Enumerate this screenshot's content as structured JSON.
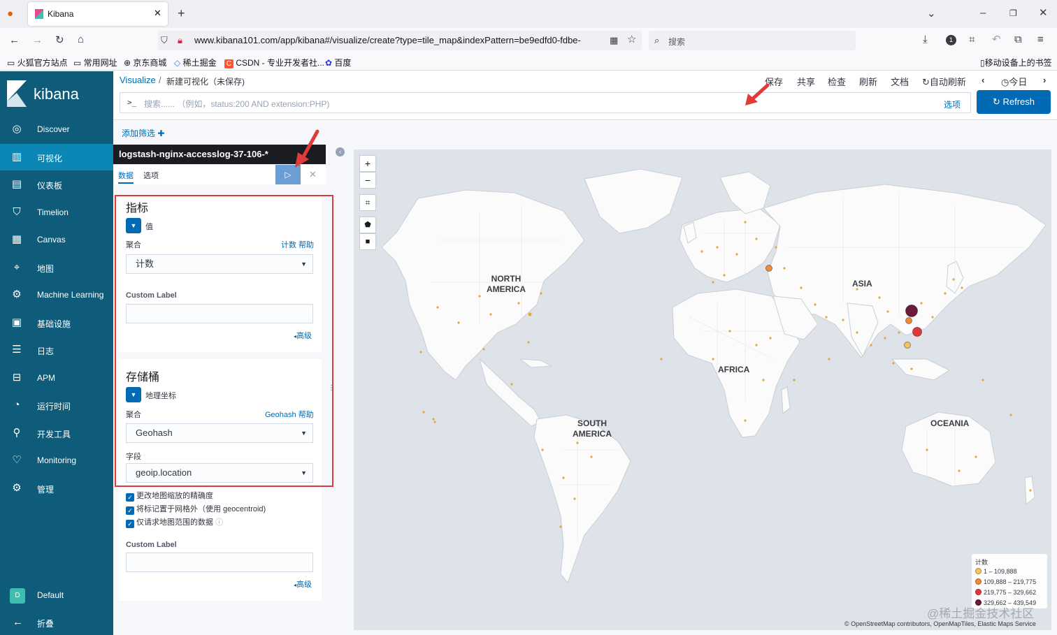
{
  "browser": {
    "tab_title": "Kibana",
    "url": "www.kibana101.com/app/kibana#/visualize/create?type=tile_map&indexPattern=be9edfd0-fdbe-",
    "search_placeholder": "搜索",
    "bookmarks": [
      "火狐官方站点",
      "常用网址",
      "京东商城",
      "稀土掘金",
      "CSDN - 专业开发者社...",
      "百度"
    ],
    "mobile_bookmarks": "移动设备上的书签"
  },
  "kibana": {
    "logo_text": "kibana",
    "breadcrumb_root": "Visualize",
    "breadcrumb_sep": "/",
    "breadcrumb_current": "新建可视化（未保存)",
    "menu": [
      "保存",
      "共享",
      "检查",
      "刷新",
      "文档"
    ],
    "auto_refresh": "自动刷新",
    "time_label": "今日",
    "query_prompt": ">_",
    "query_placeholder": "搜索...... （例如，status:200 AND extension:PHP)",
    "options_link": "选项",
    "refresh_button": "Refresh",
    "add_filter": "添加筛选"
  },
  "sidebar": {
    "items": [
      {
        "label": "Discover",
        "icon": "compass-icon"
      },
      {
        "label": "可视化",
        "icon": "chart-icon"
      },
      {
        "label": "仪表板",
        "icon": "dashboard-icon"
      },
      {
        "label": "Timelion",
        "icon": "shield-icon"
      },
      {
        "label": "Canvas",
        "icon": "canvas-icon"
      },
      {
        "label": "地图",
        "icon": "map-pin-icon"
      },
      {
        "label": "Machine Learning",
        "icon": "ml-icon"
      },
      {
        "label": "基础设施",
        "icon": "infra-icon"
      },
      {
        "label": "日志",
        "icon": "log-icon"
      },
      {
        "label": "APM",
        "icon": "apm-icon"
      },
      {
        "label": "运行时间",
        "icon": "uptime-icon"
      },
      {
        "label": "开发工具",
        "icon": "wrench-icon"
      },
      {
        "label": "Monitoring",
        "icon": "heartbeat-icon"
      },
      {
        "label": "管理",
        "icon": "gear-icon"
      }
    ],
    "space_badge": "D",
    "space_name": "Default",
    "collapse": "折叠"
  },
  "editor": {
    "index_pattern": "logstash-nginx-accesslog-37-106-*",
    "tabs": [
      "数据",
      "选项"
    ],
    "metrics": {
      "title": "指标",
      "item": "值",
      "agg_label": "聚合",
      "agg_help": "计数 帮助",
      "agg_value": "计数",
      "custom_label": "Custom Label",
      "advanced": "高级"
    },
    "buckets": {
      "title": "存储桶",
      "item": "地理坐标",
      "agg_label": "聚合",
      "agg_help": "Geohash 帮助",
      "agg_value": "Geohash",
      "field_label": "字段",
      "field_value": "geoip.location",
      "checkboxes": [
        "更改地图缩放的精确度",
        "将标记置于网格外（使用 geocentroid)",
        "仅请求地图范围的数据"
      ],
      "custom_label": "Custom Label",
      "advanced": "高级"
    }
  },
  "map": {
    "labels": {
      "north_america": [
        "NORTH",
        "AMERICA"
      ],
      "south_america": [
        "SOUTH",
        "AMERICA"
      ],
      "africa": "AFRICA",
      "asia": "ASIA",
      "oceania": "OCEANIA"
    },
    "legend": {
      "title": "计数",
      "ranges": [
        {
          "label": "1 – 109,888",
          "color": "#f5c45e"
        },
        {
          "label": "109,888 – 219,775",
          "color": "#f08b3a"
        },
        {
          "label": "219,775 – 329,662",
          "color": "#e0373a"
        },
        {
          "label": "329,662 – 439,549",
          "color": "#6b1a3a"
        }
      ]
    },
    "attribution": "© OpenStreetMap contributors, OpenMapTiles, Elastic Maps Service",
    "watermark": "@稀土掘金技术社区"
  }
}
